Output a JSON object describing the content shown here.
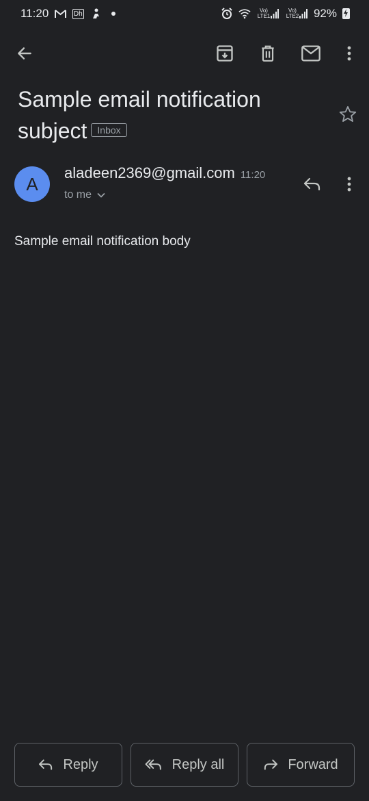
{
  "status_bar": {
    "time": "11:20",
    "left_icons": [
      "gmail-icon",
      "dh-app-icon",
      "person-icon",
      "dot-icon"
    ],
    "dh_label": "Dh",
    "right_icons": [
      "alarm-icon",
      "wifi-icon",
      "lte1-signal-icon",
      "lte2-signal-icon",
      "battery-charging-icon"
    ],
    "lte1_label": "Vo) LTE1",
    "lte2_label": "Vo) LTE2",
    "battery": "92%"
  },
  "toolbar": {
    "icons": [
      "back-arrow-icon",
      "archive-icon",
      "delete-icon",
      "mark-unread-icon",
      "more-vert-icon"
    ]
  },
  "email": {
    "subject": "Sample email notification subject",
    "label": "Inbox",
    "sender": "aladeen2369@gmail.com",
    "avatar_letter": "A",
    "avatar_color": "#5b8def",
    "time": "11:20",
    "recipients": "to me",
    "body": "Sample email notification body"
  },
  "actions": {
    "reply": "Reply",
    "reply_all": "Reply all",
    "forward": "Forward"
  },
  "colors": {
    "background": "#202124",
    "text": "#e8eaed",
    "muted": "#9aa0a6",
    "border": "#5f6368"
  }
}
